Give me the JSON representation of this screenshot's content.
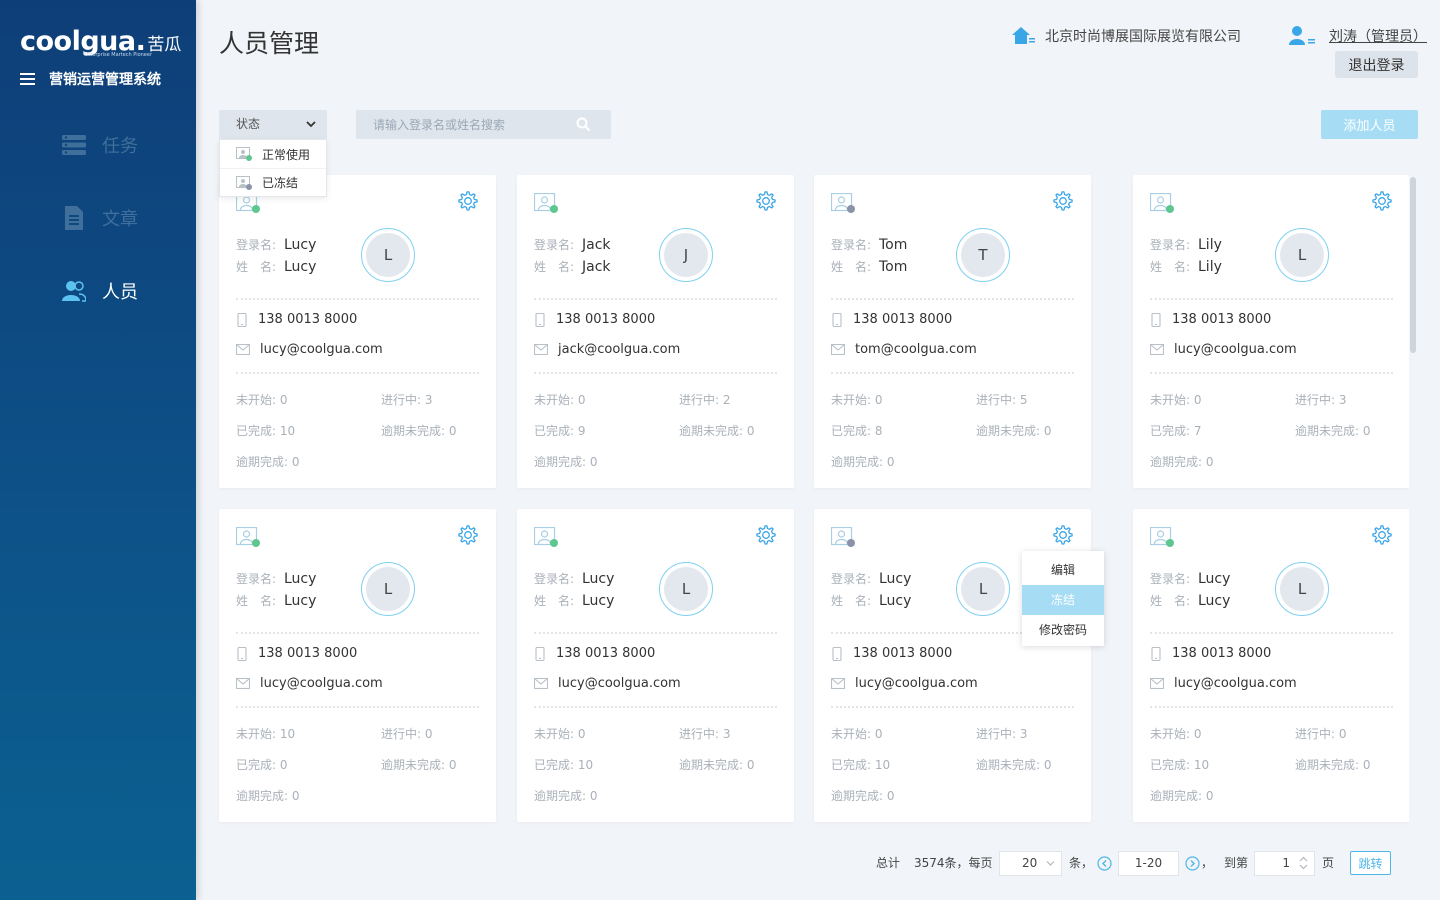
{
  "brand": {
    "logo_word": "coolgua.",
    "logo_cn": "苦瓜",
    "logo_sub": "Enterprise Martech Pioneer",
    "system_title": "营销运营管理系统"
  },
  "nav": [
    {
      "label": "任务",
      "icon": "task-list-icon",
      "state": "inactive"
    },
    {
      "label": "文章",
      "icon": "document-icon",
      "state": "inactive"
    },
    {
      "label": "人员",
      "icon": "people-icon",
      "state": "active"
    }
  ],
  "header": {
    "title": "人员管理",
    "company": "北京时尚博展国际展览有限公司",
    "user": "刘涛（管理员）",
    "logout": "退出登录"
  },
  "toolbar": {
    "status_label": "状态",
    "status_options": [
      "正常使用",
      "已冻结"
    ],
    "search_placeholder": "请输入登录名或姓名搜索",
    "add_label": "添加人员"
  },
  "labels": {
    "login": "登录名:",
    "name": "姓　名:",
    "not_started": "未开始:",
    "in_progress": "进行中:",
    "done": "已完成:",
    "overdue_undone": "逾期未完成:",
    "overdue_done": "逾期完成:"
  },
  "cards": [
    {
      "login": "Lucy",
      "name": "Lucy",
      "initial": "L",
      "phone": "138 0013 8000",
      "email": "lucy@coolgua.com",
      "not_started": "0",
      "in_progress": "3",
      "done": "10",
      "overdue_undone": "0",
      "overdue_done": "0",
      "status": "active"
    },
    {
      "login": "Jack",
      "name": "Jack",
      "initial": "J",
      "phone": "138 0013 8000",
      "email": "jack@coolgua.com",
      "not_started": "0",
      "in_progress": "2",
      "done": "9",
      "overdue_undone": "0",
      "overdue_done": "0",
      "status": "active"
    },
    {
      "login": "Tom",
      "name": "Tom",
      "initial": "T",
      "phone": "138 0013 8000",
      "email": "tom@coolgua.com",
      "not_started": "0",
      "in_progress": "5",
      "done": "8",
      "overdue_undone": "0",
      "overdue_done": "0",
      "status": "frozen"
    },
    {
      "login": "Lily",
      "name": "Lily",
      "initial": "L",
      "phone": "138 0013 8000",
      "email": "lucy@coolgua.com",
      "not_started": "0",
      "in_progress": "3",
      "done": "7",
      "overdue_undone": "0",
      "overdue_done": "0",
      "status": "active"
    },
    {
      "login": "Lucy",
      "name": "Lucy",
      "initial": "L",
      "phone": "138 0013 8000",
      "email": "lucy@coolgua.com",
      "not_started": "10",
      "in_progress": "0",
      "done": "0",
      "overdue_undone": "0",
      "overdue_done": "0",
      "status": "active"
    },
    {
      "login": "Lucy",
      "name": "Lucy",
      "initial": "L",
      "phone": "138 0013 8000",
      "email": "lucy@coolgua.com",
      "not_started": "0",
      "in_progress": "3",
      "done": "10",
      "overdue_undone": "0",
      "overdue_done": "0",
      "status": "active"
    },
    {
      "login": "Lucy",
      "name": "Lucy",
      "initial": "L",
      "phone": "138 0013 8000",
      "email": "lucy@coolgua.com",
      "not_started": "0",
      "in_progress": "3",
      "done": "10",
      "overdue_undone": "0",
      "overdue_done": "0",
      "status": "frozen"
    },
    {
      "login": "Lucy",
      "name": "Lucy",
      "initial": "L",
      "phone": "138 0013 8000",
      "email": "lucy@coolgua.com",
      "not_started": "0",
      "in_progress": "0",
      "done": "10",
      "overdue_undone": "0",
      "overdue_done": "0",
      "status": "active"
    }
  ],
  "context_menu": {
    "items": [
      "编辑",
      "冻结",
      "修改密码"
    ],
    "highlighted": "冻结"
  },
  "pagination": {
    "total_prefix": "总计",
    "total": "3574条，每页",
    "page_size": "20",
    "unit": "条，",
    "range": "1-20",
    "comma": "，",
    "goto_label": "到第",
    "goto_page": "1",
    "page_label": "页",
    "jump": "跳转"
  },
  "colors": {
    "sidebar": "#0e3e78",
    "accent": "#4fb6e8",
    "accent_light": "#a6ddf5",
    "background": "#f1f4f8"
  }
}
